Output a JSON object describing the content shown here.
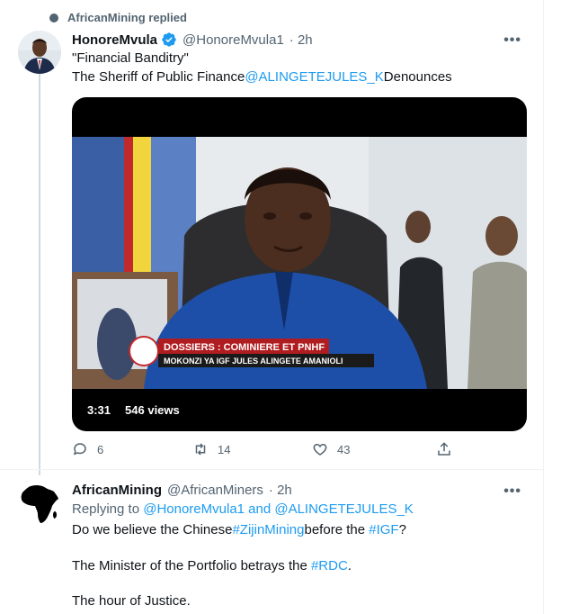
{
  "social_context": {
    "text": "AfricanMining replied"
  },
  "tweet1": {
    "name": "HonoreMvula",
    "handle": "@HonoreMvula1",
    "time": "· 2h",
    "line1": "\"Financial Banditry\"",
    "line2_prefix": "The Sheriff of Public Finance",
    "line2_mention": "@ALINGETEJULES_K",
    "line2_suffix": "Denounces",
    "video": {
      "banner_top": "DOSSIERS : COMINIERE ET PNHF",
      "banner_bottom": "MOKONZI YA IGF JULES ALINGETE AMANIOLI",
      "duration": "3:31",
      "views": "546 views"
    },
    "actions": {
      "replies": "6",
      "retweets": "14",
      "likes": "43"
    }
  },
  "tweet2": {
    "name": "AfricanMining",
    "handle": "@AfricanMiners",
    "time": "· 2h",
    "replying_prefix": "Replying to",
    "replying_users": "@HonoreMvula1 and @ALINGETEJULES_K",
    "p1_prefix": "Do we believe the Chinese",
    "p1_tag1": "#ZijinMining",
    "p1_mid": "before the",
    "p1_tag2": "#IGF",
    "p1_suffix": "?",
    "p2_prefix": "The Minister of the Portfolio betrays the",
    "p2_tag": "#RDC",
    "p2_suffix": ".",
    "p3": "The hour of Justice."
  },
  "more_glyph": "•••",
  "colors": {
    "accent": "#1d9bf0",
    "muted": "#536471",
    "text": "#0f1419"
  },
  "icons": [
    "reply-icon",
    "retweet-icon",
    "like-icon",
    "share-icon",
    "verified-badge-icon",
    "more-icon"
  ]
}
